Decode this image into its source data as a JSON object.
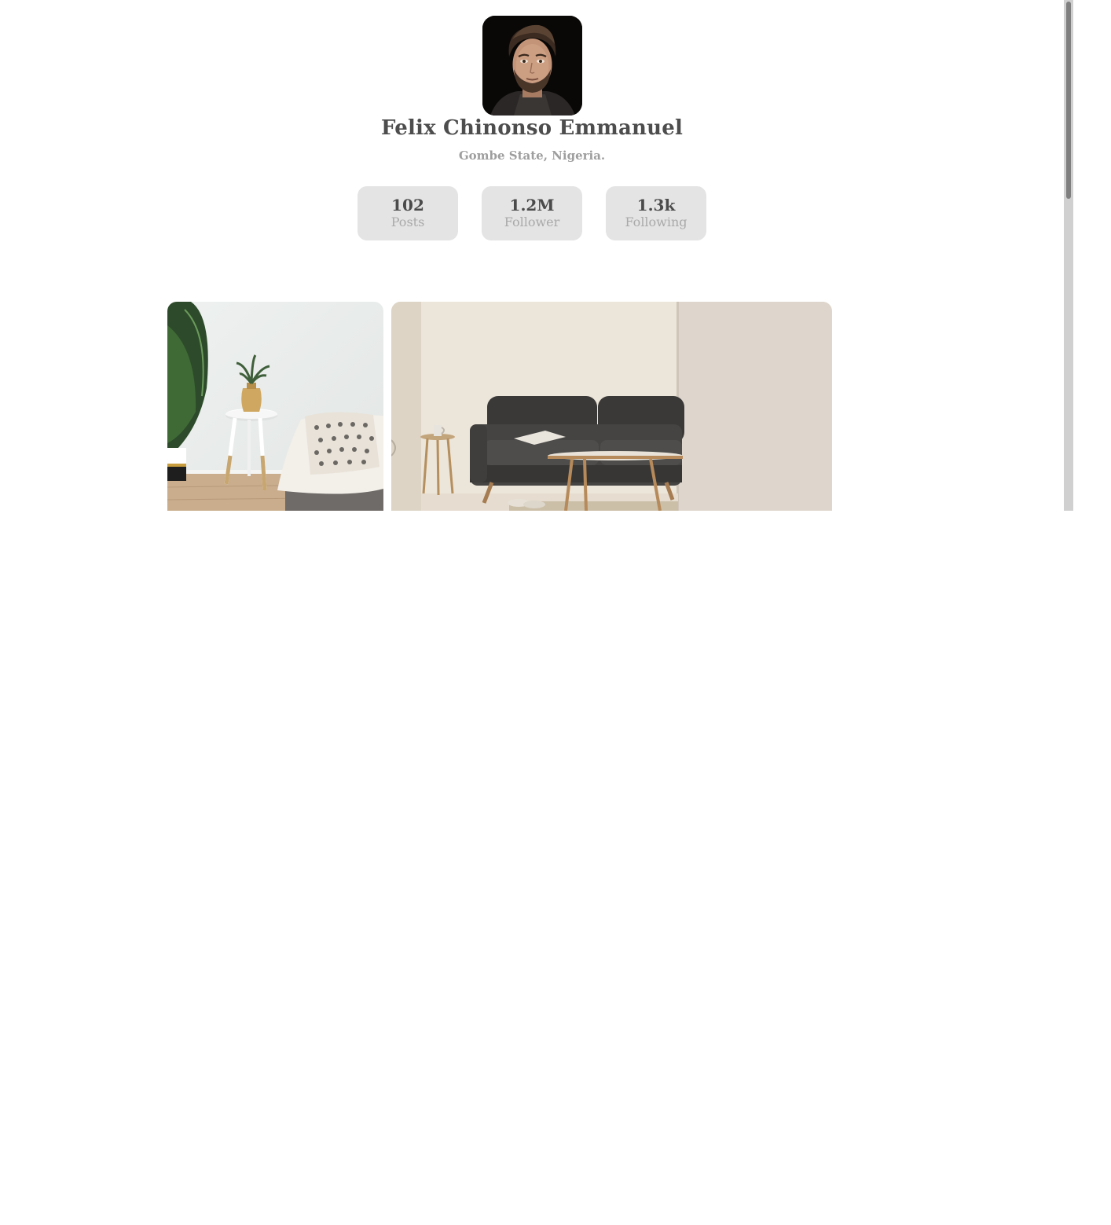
{
  "profile": {
    "name": "Felix Chinonso Emmanuel",
    "location": "Gombe State, Nigeria.",
    "avatar_icon": "portrait-photo"
  },
  "stats": [
    {
      "value": "102",
      "label": "Posts"
    },
    {
      "value": "1.2M",
      "label": "Follower"
    },
    {
      "value": "1.3k",
      "label": "Following"
    }
  ],
  "posts": [
    {
      "image": "living-room-plant-side-table-photo"
    },
    {
      "image": "dark-sofa-coffee-table-photo"
    }
  ],
  "colors": {
    "card_bg": "#e4e4e4",
    "name_text": "#4d4d4d",
    "muted_text": "#9e9e9e"
  }
}
